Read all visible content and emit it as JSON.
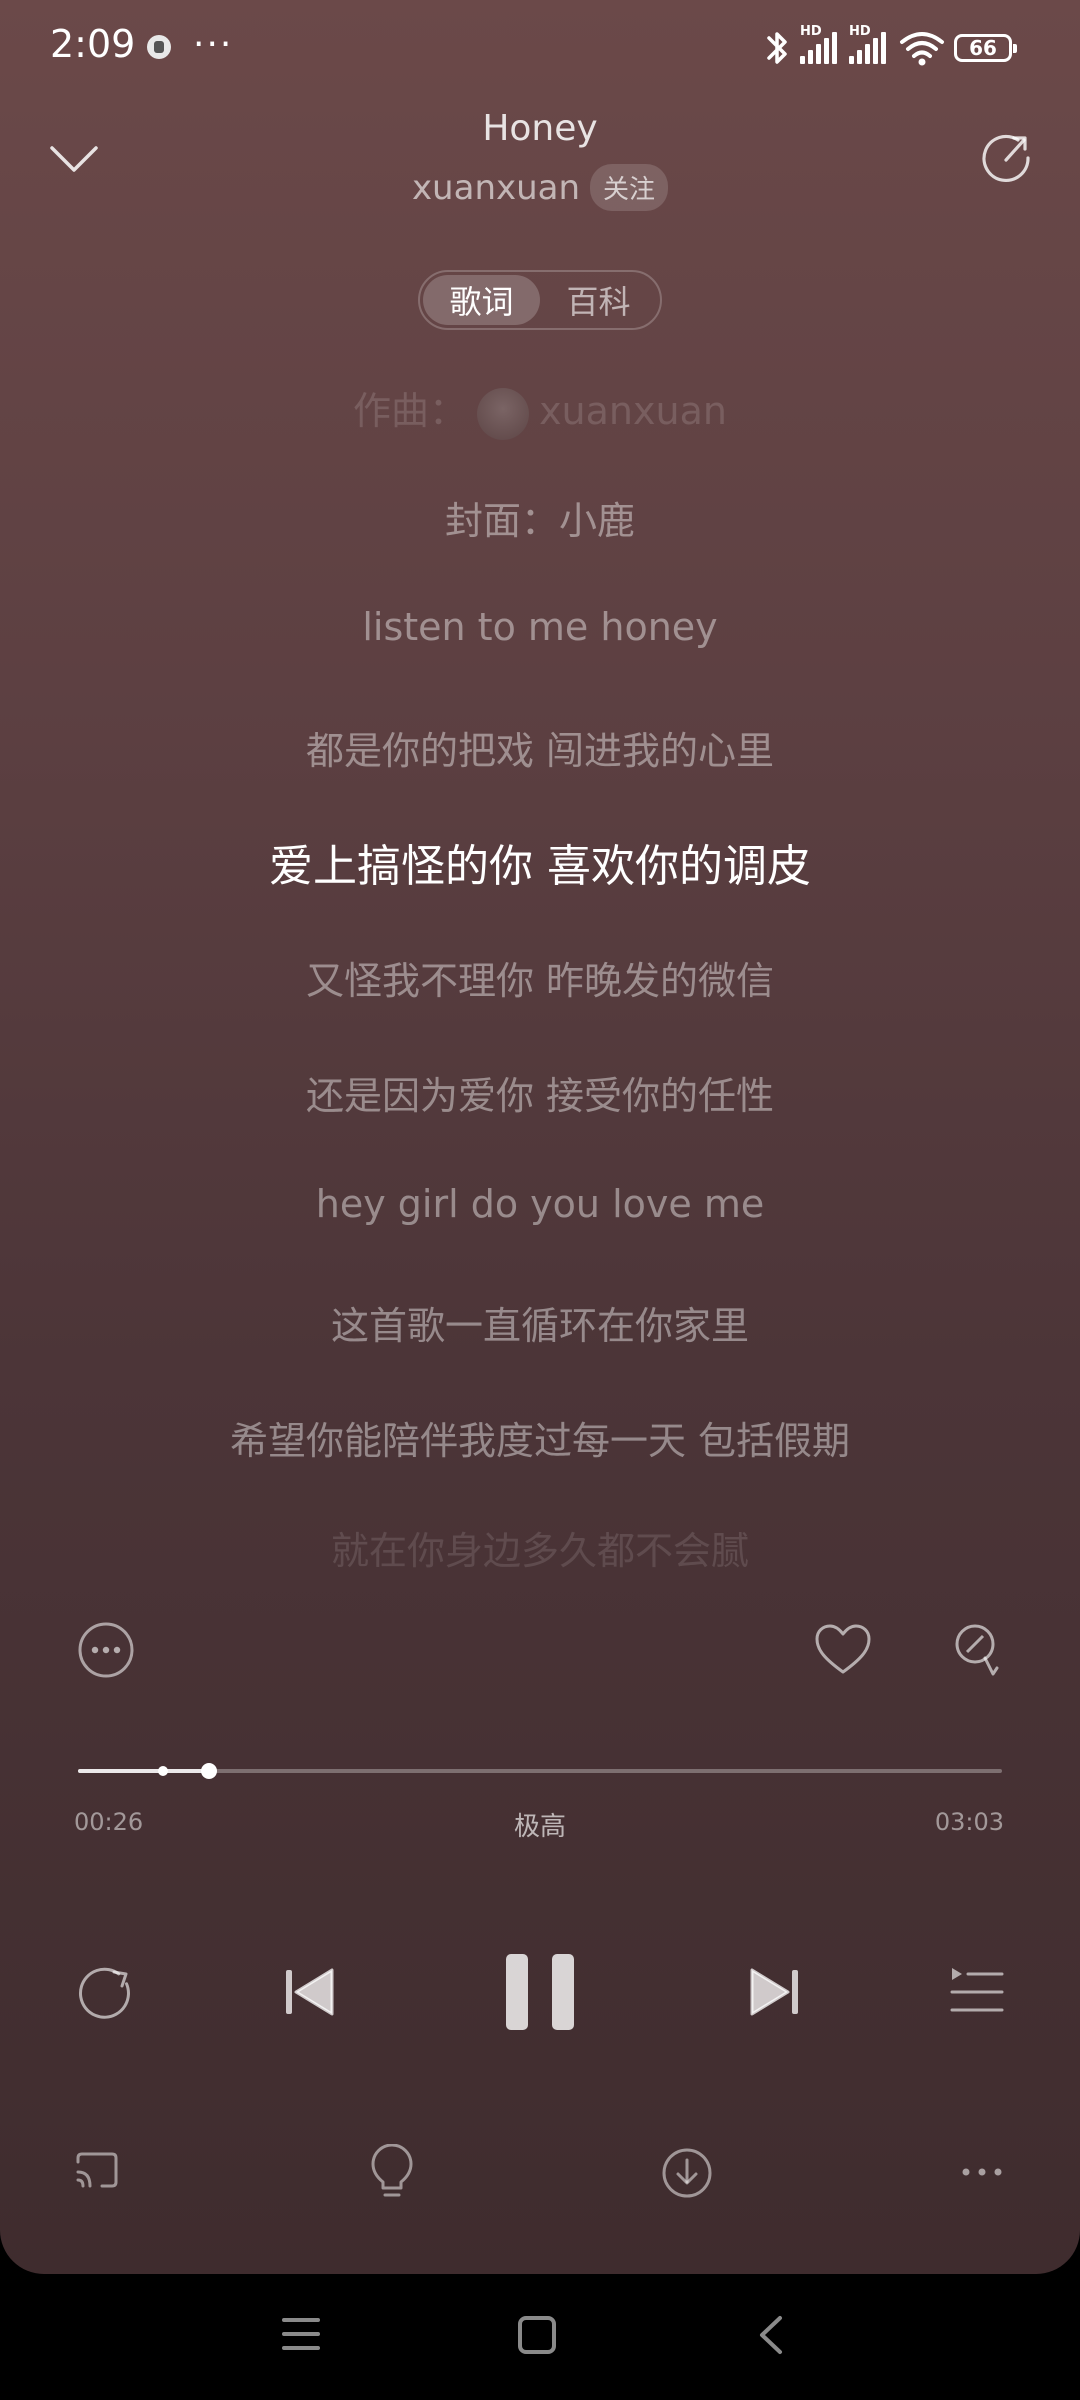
{
  "status_bar": {
    "time": "2:09",
    "more": "···",
    "battery": "66",
    "hd_label": "HD"
  },
  "header": {
    "title": "Honey",
    "artist": "xuanxuan",
    "follow_label": "关注"
  },
  "tabs": [
    {
      "label": "歌词",
      "active": true
    },
    {
      "label": "百科",
      "active": false
    }
  ],
  "lyrics": {
    "composer_prefix": "作曲：",
    "composer_name": "xuanxuan",
    "lines": [
      "封面：小鹿",
      "listen to me honey",
      "都是你的把戏 闯进我的心里",
      "爱上搞怪的你 喜欢你的调皮",
      "又怪我不理你 昨晚发的微信",
      "还是因为爱你 接受你的任性",
      "hey girl do you love me",
      "这首歌一直循环在你家里",
      "希望你能陪伴我度过每一天 包括假期",
      "就在你身边多久都不会腻"
    ],
    "current_index": 3
  },
  "player": {
    "elapsed": "00:26",
    "duration": "03:03",
    "quality": "极高",
    "progress_fraction": 0.142,
    "marker_fraction": 0.092
  },
  "colors": {
    "bg_top": "#6b4949",
    "bg_bottom": "#3f2c2e"
  }
}
